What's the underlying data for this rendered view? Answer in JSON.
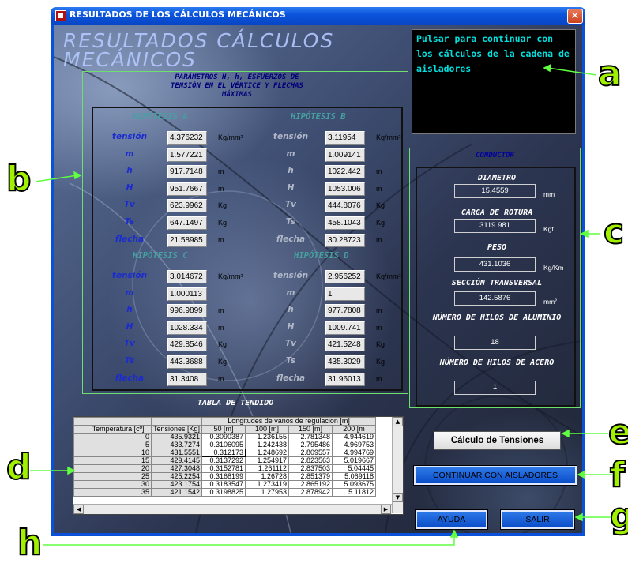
{
  "window": {
    "title": "RESULTADOS DE LOS CÁLCULOS MECÁNICOS",
    "close_glyph": "✕"
  },
  "header": {
    "big_title": "RESULTADOS CÁLCULOS\nMECÁNICOS"
  },
  "info_box": {
    "text": "Pulsar para continuar con los cálculos de la cadena de aisladores"
  },
  "params": {
    "title": "PARÁMETROS H, h, ESFUERZOS DE TENSIÓN EN EL VÉRTICE Y FLECHAS MÁXIMAS",
    "row_labels": [
      "tensión",
      "m",
      "h",
      "H",
      "Tv",
      "Ts",
      "flecha"
    ],
    "hyp_a": {
      "title": "HIPÓTESIS   A",
      "values": [
        "4.376232",
        "1.577221",
        "917.7148",
        "951.7667",
        "623.9962",
        "647.1497",
        "21.58985"
      ],
      "units": [
        "Kg/mm²",
        "",
        "m",
        "m",
        "Kg",
        "Kg",
        "m"
      ]
    },
    "hyp_b": {
      "title": "HIPÓTESIS   B",
      "values": [
        "3.11954",
        "1.009141",
        "1022.442",
        "1053.006",
        "444.8076",
        "458.1043",
        "30.28723"
      ],
      "units": [
        "Kg/mm²",
        "",
        "m",
        "m",
        "Kg",
        "Kg",
        "m"
      ]
    },
    "hyp_c": {
      "title": "HIPÓTESIS   C",
      "values": [
        "3.014672",
        "1.000113",
        "996.9899",
        "1028.334",
        "429.8546",
        "443.3688",
        "31.3408"
      ],
      "units": [
        "Kg/mm²",
        "",
        "m",
        "m",
        "Kg",
        "Kg",
        "m"
      ]
    },
    "hyp_d": {
      "title": "HIPÓTESIS   D",
      "values": [
        "2.956252",
        "1",
        "977.7808",
        "1009.741",
        "421.5248",
        "435.3029",
        "31.96013"
      ],
      "units": [
        "Kg/mm²",
        "",
        "m",
        "m",
        "Kg",
        "Kg",
        "m"
      ]
    }
  },
  "conductor": {
    "title": "CONDUCTOR",
    "fields": [
      {
        "label": "DIAMETRO",
        "value": "15.4559",
        "unit": "mm"
      },
      {
        "label": "CARGA DE ROTURA",
        "value": "3119.981",
        "unit": "Kgf"
      },
      {
        "label": "PESO",
        "value": "431.1036",
        "unit": "Kg/Km"
      },
      {
        "label": "SECCIÓN TRANSVERSAL",
        "value": "142.5876",
        "unit": "mm²"
      },
      {
        "label": "NÚMERO DE HILOS DE ALUMINIO",
        "value": "18",
        "unit": ""
      },
      {
        "label": "NÚMERO DE HILOS DE ACERO",
        "value": "1",
        "unit": ""
      }
    ]
  },
  "tabla": {
    "title": "TABLA DE TENDIDO",
    "group_header": "Longitudes de vanos de regulacion [m]",
    "col_temp": "Temperatura [cº]",
    "col_tens": "Tensiones [Kg]",
    "spans": [
      "50 [m]",
      "100 [m]",
      "150 [m]",
      "200 [m"
    ],
    "rows": [
      [
        "0",
        "435.9321",
        "0.3090387",
        "1.236155",
        "2.781348",
        "4.944619"
      ],
      [
        "5",
        "433.7274",
        "0.3106095",
        "1.242438",
        "2.795486",
        "4.969753"
      ],
      [
        "10",
        "431.5551",
        "0.312173",
        "1.248692",
        "2.809557",
        "4.994769"
      ],
      [
        "15",
        "429.4145",
        "0.3137292",
        "1.254917",
        "2.823563",
        "5.019667"
      ],
      [
        "20",
        "427.3048",
        "0.3152781",
        "1.261112",
        "2.837503",
        "5.04445"
      ],
      [
        "25",
        "425.2254",
        "0.3168199",
        "1.26728",
        "2.851379",
        "5.069118"
      ],
      [
        "30",
        "423.1754",
        "0.3183547",
        "1.273419",
        "2.865192",
        "5.093675"
      ],
      [
        "35",
        "421.1542",
        "0.3198825",
        "1.27953",
        "2.878942",
        "5.11812"
      ]
    ]
  },
  "buttons": {
    "calc_tensiones": "Cálculo de Tensiones",
    "continuar": "CONTINUAR CON AISLADORES",
    "ayuda": "AYUDA",
    "salir": "SALIR"
  },
  "annotations": [
    "a",
    "b",
    "c",
    "d",
    "e",
    "f",
    "g",
    "h"
  ],
  "colors": {
    "annotation": "#a0f000",
    "titlebar": "#0a54dc",
    "info_text": "#00e0e0"
  }
}
